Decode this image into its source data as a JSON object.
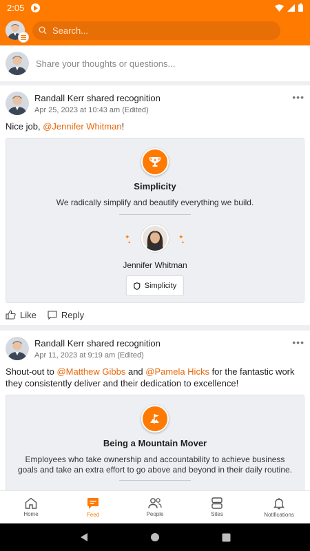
{
  "status_bar": {
    "time": "2:05"
  },
  "search": {
    "placeholder": "Search..."
  },
  "composer": {
    "placeholder": "Share your thoughts or questions..."
  },
  "posts": [
    {
      "author": "Randall Kerr",
      "action": "shared recognition",
      "date": "Apr 25, 2023 at 10:43 am (Edited)",
      "body_prefix": "Nice job, ",
      "mention_1": "@Jennifer Whitman",
      "body_suffix": "!",
      "value_title": "Simplicity",
      "value_description": "We radically simplify and beautify everything we build.",
      "recipient": "Jennifer Whitman",
      "value_chip": "Simplicity",
      "like_label": "Like",
      "reply_label": "Reply"
    },
    {
      "author": "Randall Kerr",
      "action": "shared recognition",
      "date": "Apr 11, 2023 at 9:19 am (Edited)",
      "body_prefix": "Shout-out to ",
      "mention_1": "@Matthew Gibbs",
      "body_middle": " and ",
      "mention_2": "@Pamela Hicks",
      "body_suffix": " for the fantastic work they consistently deliver and their dedication to excellence!",
      "value_title": "Being a Mountain Mover",
      "value_description": "Employees who take ownership and accountability to achieve business goals and take an extra effort to go above and beyond in their daily routine."
    }
  ],
  "bottom_nav": [
    {
      "label": "Home",
      "icon": "home-icon"
    },
    {
      "label": "Feed",
      "icon": "feed-icon",
      "active": true
    },
    {
      "label": "People",
      "icon": "people-icon"
    },
    {
      "label": "Sites",
      "icon": "sites-icon"
    },
    {
      "label": "Notifications",
      "icon": "bell-icon"
    }
  ],
  "colors": {
    "brand": "#ff7a00",
    "mention": "#e8670b"
  }
}
